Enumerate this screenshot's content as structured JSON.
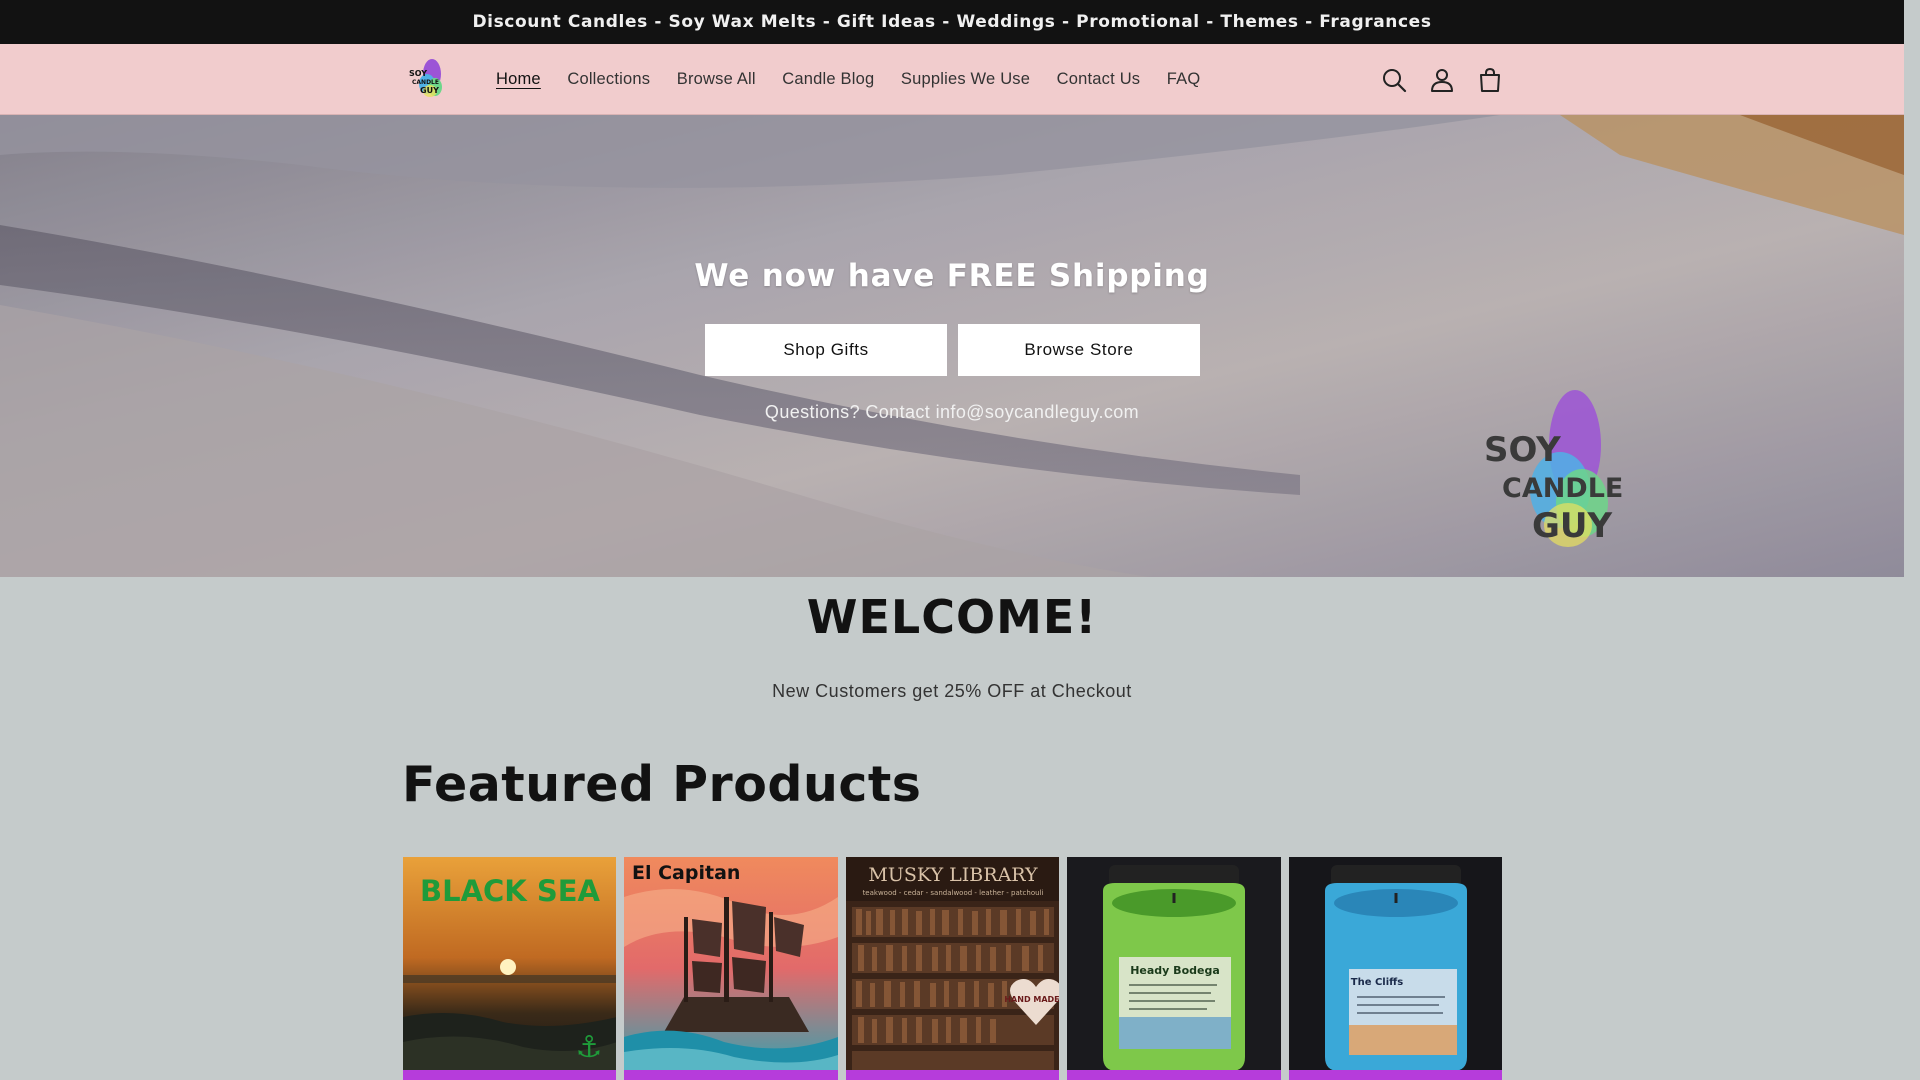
{
  "announcement": "Discount Candles - Soy Wax Melts - Gift Ideas - Weddings - Promotional - Themes - Fragrances",
  "nav": {
    "items": [
      {
        "label": "Home",
        "active": true
      },
      {
        "label": "Collections"
      },
      {
        "label": "Browse All"
      },
      {
        "label": "Candle Blog"
      },
      {
        "label": "Supplies We Use"
      },
      {
        "label": "Contact Us"
      },
      {
        "label": "FAQ"
      }
    ],
    "icons": [
      "search-icon",
      "account-icon",
      "cart-icon"
    ]
  },
  "hero": {
    "title": "We now have FREE Shipping",
    "buttons": [
      "Shop Gifts",
      "Browse Store"
    ],
    "note": "Questions? Contact info@soycandleguy.com",
    "logo_text": [
      "SOY",
      "CANDLE",
      "GUY"
    ]
  },
  "welcome": {
    "title": "WELCOME!",
    "promo": "New Customers get 25% OFF at Checkout"
  },
  "featured": {
    "title": "Featured Products",
    "products": [
      {
        "image_text": "BLACK SEA"
      },
      {
        "image_text": "El Capitan"
      },
      {
        "image_text": "MUSKY LIBRARY",
        "image_subtext": "teakwood - cedar - sandalwood - leather - patchouli",
        "badge": "HAND MADE"
      },
      {
        "image_text": "Heady Bodega"
      },
      {
        "image_text": "The Cliffs"
      }
    ]
  },
  "colors": {
    "announcement_bg": "#121212",
    "header_bg": "#f1cccd",
    "page_bg": "#c5cbcb",
    "product_bar": "#b63cdb"
  }
}
